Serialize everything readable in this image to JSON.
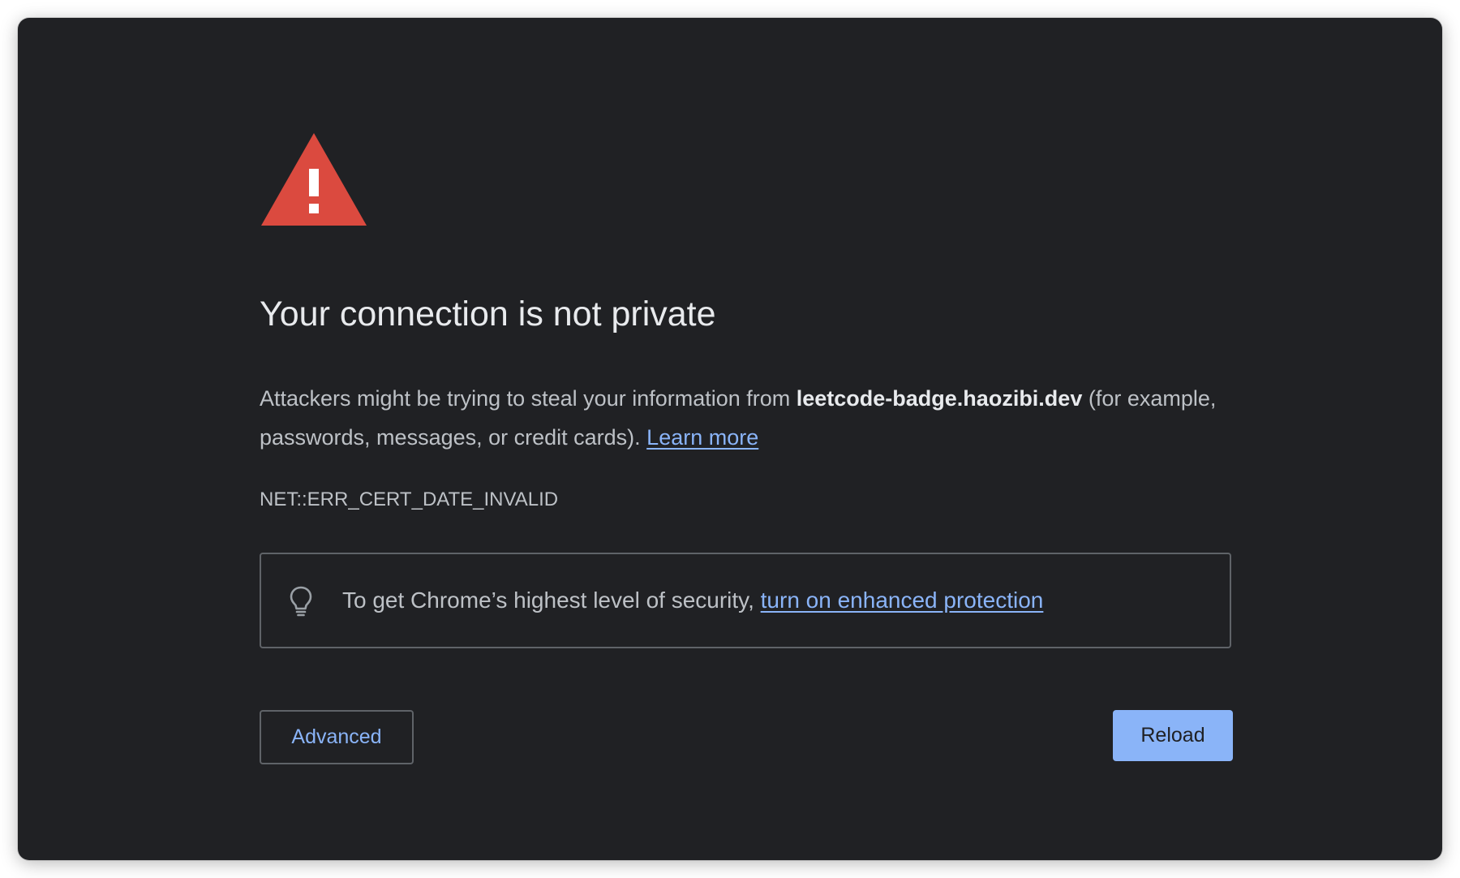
{
  "colors": {
    "background": "#202124",
    "warning_red": "#d93025",
    "link_blue": "#8ab4f8",
    "text_primary": "#e8eaed",
    "text_secondary": "#bdc1c6",
    "border": "#5f6368"
  },
  "icons": {
    "warning": "warning-triangle-icon",
    "promo": "lightbulb-icon"
  },
  "page": {
    "title": "Your connection is not private",
    "description": {
      "prefix": "Attackers might be trying to steal your information from ",
      "host": "leetcode-badge.haozibi.dev",
      "suffix": " (for example, passwords, messages, or credit cards). ",
      "learn_more": "Learn more"
    },
    "error_code": "NET::ERR_CERT_DATE_INVALID",
    "promo": {
      "text": "To get Chrome’s highest level of security, ",
      "link": "turn on enhanced protection"
    }
  },
  "buttons": {
    "advanced": "Advanced",
    "reload": "Reload"
  }
}
